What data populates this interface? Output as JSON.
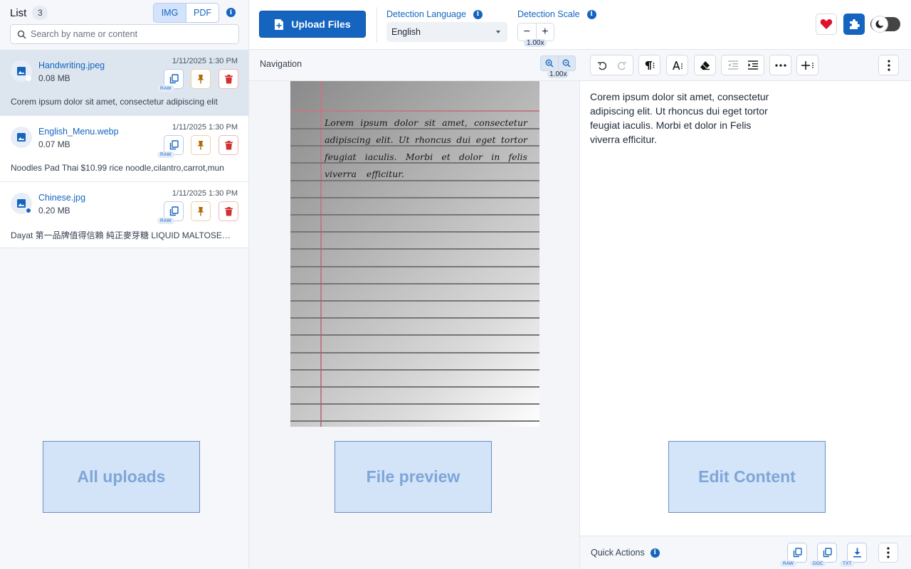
{
  "sidebar": {
    "title": "List",
    "count": "3",
    "mode_img": "IMG",
    "mode_pdf": "PDF",
    "search_placeholder": "Search by name or content",
    "files": [
      {
        "name": "Handwriting.jpeg",
        "size": "0.08 MB",
        "date": "1/11/2025 1:30 PM",
        "preview": "Corem ipsum dolor sit amet, consectetur adipiscing elit",
        "raw": "RAW"
      },
      {
        "name": "English_Menu.webp",
        "size": "0.07 MB",
        "date": "1/11/2025 1:30 PM",
        "preview": "Noodles Pad Thai $10.99 rice noodle,cilantro,carrot,mun",
        "raw": "RAW"
      },
      {
        "name": "Chinese.jpg",
        "size": "0.20 MB",
        "date": "1/11/2025 1:30 PM",
        "preview": "Dayat 第一品牌值得信賴 純正麥芽糖 LIQUID MALTOSE…",
        "raw": "RAW"
      }
    ]
  },
  "topbar": {
    "upload_label": "Upload Files",
    "lang_label": "Detection Language",
    "lang_value": "English",
    "scale_label": "Detection Scale",
    "scale_value": "1.00x"
  },
  "preview": {
    "nav_title": "Navigation",
    "zoom_value": "1.00x",
    "handwriting_lines": [
      [
        "Lorem",
        "ipsum",
        "dolor",
        "sit",
        "amet,",
        "consectetur"
      ],
      [
        "adipiscing",
        "elit.",
        "Ut",
        "rhoncus",
        "dui",
        "eget",
        "tortor"
      ],
      [
        "feugiat",
        "iaculis.",
        "Morbi",
        "et",
        "dolor",
        "in",
        "felis"
      ],
      [
        "viverra",
        "efficitur."
      ]
    ]
  },
  "editor": {
    "content": "Corem ipsum dolor sit amet, consectetur adipiscing elit. Ut rhoncus dui eget tortor feugiat iaculis. Morbi et dolor in Felis viverra efficitur.",
    "quick_actions_label": "Quick Actions",
    "tag_raw": "RAW",
    "tag_doc": "DOC",
    "tag_txt": "TXT"
  },
  "regions": {
    "all_uploads": "All uploads",
    "file_preview": "File preview",
    "edit_content": "Edit Content"
  },
  "colors": {
    "accent": "#1565c0",
    "danger": "#d32f2f",
    "pin": "#b26a00"
  }
}
